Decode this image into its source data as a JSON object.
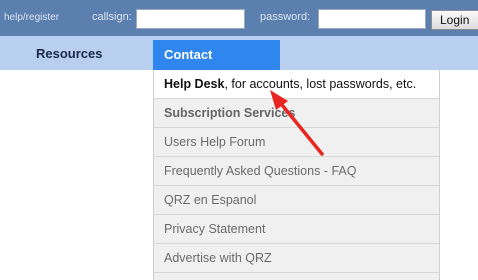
{
  "topbar": {
    "help_register": "help/register",
    "callsign_label": "callsign:",
    "callsign_value": "",
    "password_label": "password:",
    "password_value": "",
    "login_label": "Login"
  },
  "nav": {
    "resources": "Resources",
    "contact": "Contact"
  },
  "dropdown": {
    "help_desk_bold": "Help Desk",
    "help_desk_rest": ", for accounts, lost passwords, etc.",
    "items": [
      "Subscription Services",
      "Users Help Forum",
      "Frequently Asked Questions - FAQ",
      "QRZ en Espanol",
      "Privacy Statement",
      "Advertise with QRZ"
    ]
  },
  "colors": {
    "topbar": "#5b7fae",
    "navbar": "#b9cff0",
    "contact_tab": "#2f86ee",
    "arrow": "#e8261f"
  }
}
